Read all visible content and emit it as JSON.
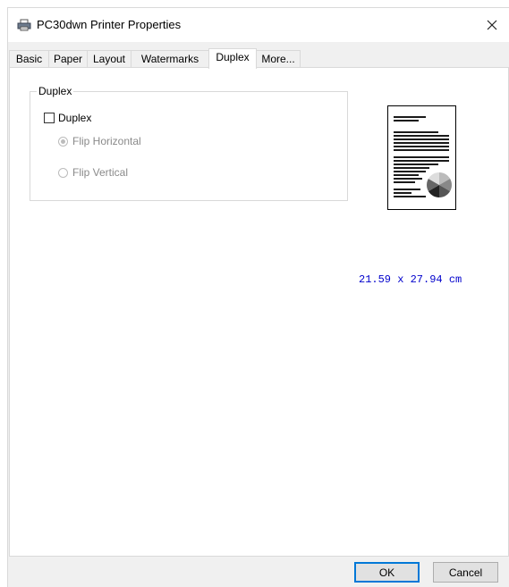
{
  "window": {
    "title": "PC30dwn Printer Properties"
  },
  "tabs": [
    {
      "label": "Basic"
    },
    {
      "label": "Paper"
    },
    {
      "label": "Layout"
    },
    {
      "label": "Watermarks"
    },
    {
      "label": "Duplex",
      "active": true
    },
    {
      "label": "More..."
    }
  ],
  "duplex_group": {
    "legend": "Duplex",
    "duplex_checkbox": {
      "label": "Duplex",
      "checked": false
    },
    "flip_horizontal": {
      "label": "Flip Horizontal",
      "selected": true,
      "enabled": false
    },
    "flip_vertical": {
      "label": "Flip Vertical",
      "selected": false,
      "enabled": false
    }
  },
  "preview": {
    "paper_size": "21.59 x 27.94 cm"
  },
  "buttons": {
    "ok": "OK",
    "cancel": "Cancel"
  },
  "colors": {
    "paper_size_text": "#0000cc",
    "default_button_border": "#0078d7"
  },
  "icons": {
    "window_icon": "printer-icon",
    "close": "close-icon"
  }
}
